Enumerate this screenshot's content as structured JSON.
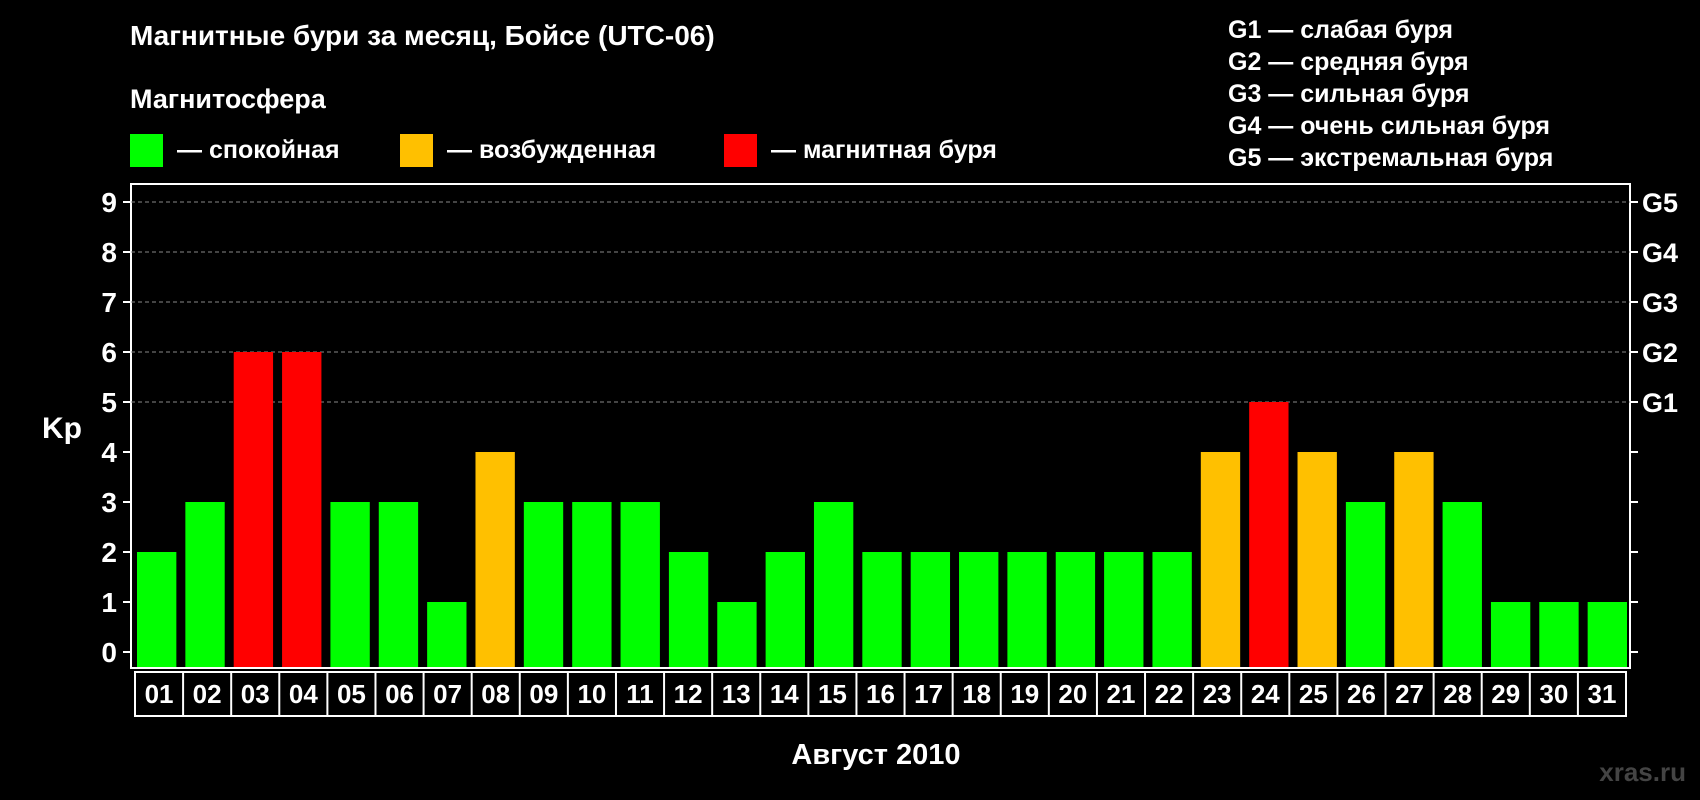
{
  "title": "Магнитные бури за месяц, Бойсе (UTC-06)",
  "subtitle": "Магнитосфера",
  "legend": [
    {
      "label": "— спокойная",
      "color": "#00ff00"
    },
    {
      "label": "— возбужденная",
      "color": "#ffc000"
    },
    {
      "label": "— магнитная буря",
      "color": "#ff0000"
    }
  ],
  "storm_scale": [
    "G1 — слабая буря",
    "G2 — средняя буря",
    "G3 — сильная буря",
    "G4 — очень сильная буря",
    "G5 — экстремальная буря"
  ],
  "watermark": "xras.ru",
  "chart_data": {
    "type": "bar",
    "title": "Магнитные бури за месяц, Бойсе (UTC-06)",
    "xlabel": "Август 2010",
    "ylabel": "Kp",
    "ylim": [
      0,
      9
    ],
    "yticks": [
      0,
      1,
      2,
      3,
      4,
      5,
      6,
      7,
      8,
      9
    ],
    "right_axis_labels": [
      {
        "kp": 5,
        "label": "G1"
      },
      {
        "kp": 6,
        "label": "G2"
      },
      {
        "kp": 7,
        "label": "G3"
      },
      {
        "kp": 8,
        "label": "G4"
      },
      {
        "kp": 9,
        "label": "G5"
      }
    ],
    "grid": "dashed horizontal at Kp 5–9",
    "categories": [
      "01",
      "02",
      "03",
      "04",
      "05",
      "06",
      "07",
      "08",
      "09",
      "10",
      "11",
      "12",
      "13",
      "14",
      "15",
      "16",
      "17",
      "18",
      "19",
      "20",
      "21",
      "22",
      "23",
      "24",
      "25",
      "26",
      "27",
      "28",
      "29",
      "30",
      "31"
    ],
    "values": [
      2,
      3,
      6,
      6,
      3,
      3,
      1,
      4,
      3,
      3,
      3,
      2,
      1,
      2,
      3,
      2,
      2,
      2,
      2,
      2,
      2,
      2,
      4,
      5,
      4,
      3,
      4,
      3,
      1,
      1,
      1
    ],
    "color_rule": {
      "quiet": "#00ff00",
      "disturbed": "#ffc000",
      "storm": "#ff0000"
    }
  }
}
